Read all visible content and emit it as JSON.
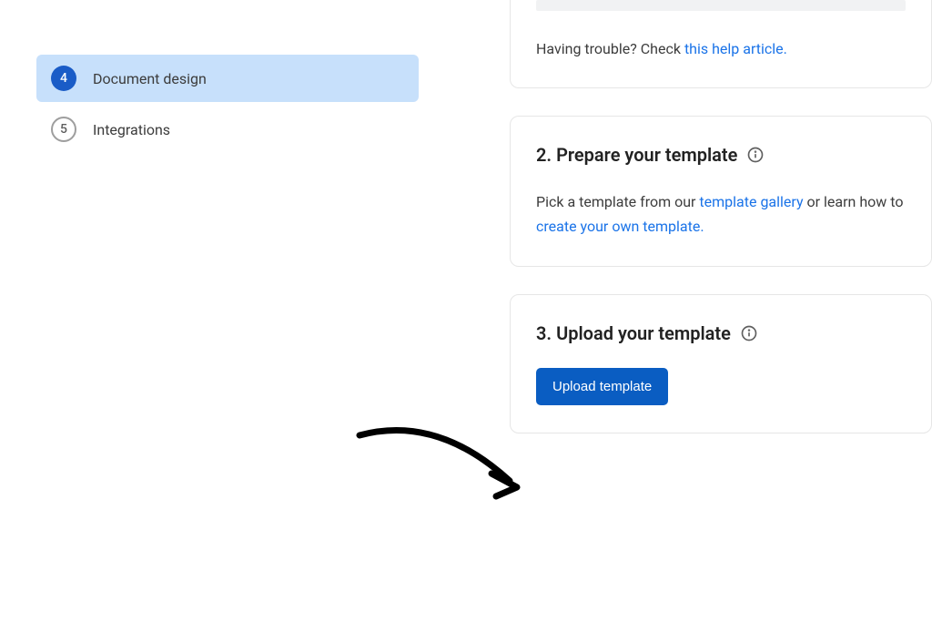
{
  "sidebar": {
    "items": [
      {
        "number": "4",
        "label": "Document design",
        "active": true
      },
      {
        "number": "5",
        "label": "Integrations",
        "active": false
      }
    ]
  },
  "card1": {
    "text_before": "Having trouble? Check ",
    "link": "this help article."
  },
  "card2": {
    "title": "2. Prepare your template",
    "body_before": "Pick a template from our ",
    "link1": "template gallery",
    "body_mid": " or learn how to ",
    "link2": "create your own template."
  },
  "card3": {
    "title": "3. Upload your template",
    "button": "Upload template"
  }
}
